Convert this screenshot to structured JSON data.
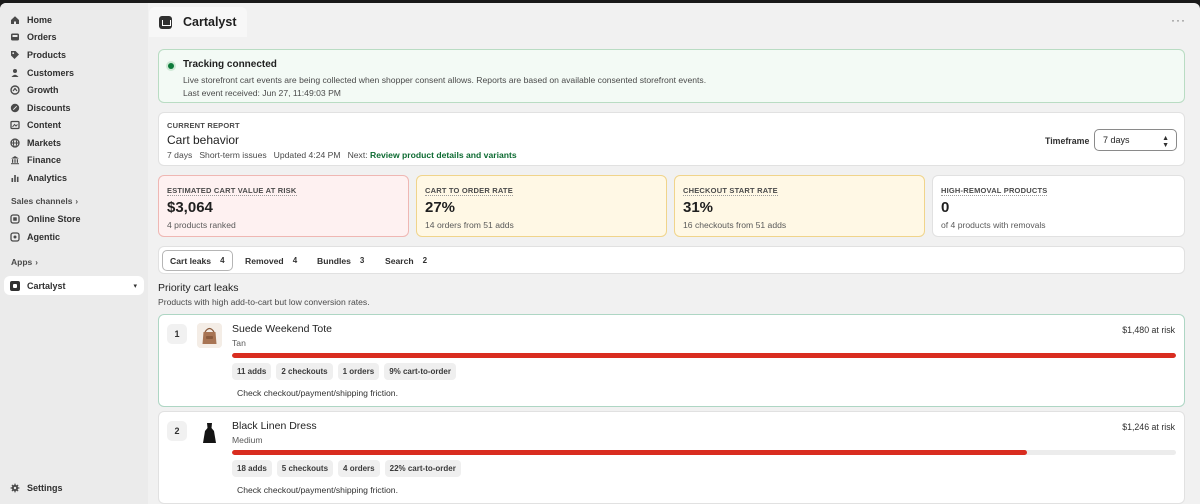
{
  "sidebar": {
    "items": [
      {
        "label": "Home",
        "icon": "home-icon"
      },
      {
        "label": "Orders",
        "icon": "orders-icon"
      },
      {
        "label": "Products",
        "icon": "tag-icon"
      },
      {
        "label": "Customers",
        "icon": "person-icon"
      },
      {
        "label": "Growth",
        "icon": "growth-icon"
      },
      {
        "label": "Discounts",
        "icon": "discount-icon"
      },
      {
        "label": "Content",
        "icon": "content-icon"
      },
      {
        "label": "Markets",
        "icon": "globe-icon"
      },
      {
        "label": "Finance",
        "icon": "bank-icon"
      },
      {
        "label": "Analytics",
        "icon": "chart-bar-icon"
      }
    ],
    "sales_channels_heading": "Sales channels",
    "sales_channels": [
      {
        "label": "Online Store",
        "icon": "store-icon"
      },
      {
        "label": "Agentic",
        "icon": "agentic-icon"
      }
    ],
    "apps_heading": "Apps",
    "active_app": "Cartalyst",
    "settings_label": "Settings"
  },
  "header": {
    "app_title": "Cartalyst",
    "more_label": "···"
  },
  "banner": {
    "title": "Tracking connected",
    "description": "Live storefront cart events are being collected when shopper consent allows. Reports are based on available consented storefront events.",
    "last_event": "Last event received: Jun 27, 11:49:03 PM"
  },
  "report": {
    "eyebrow": "CURRENT REPORT",
    "title": "Cart behavior",
    "period": "7 days",
    "scope": "Short-term issues",
    "updated": "Updated 4:24 PM",
    "next_prefix": "Next:",
    "next_action": "Review product details and variants",
    "timeframe_label": "Timeframe",
    "timeframe_value": "7 days"
  },
  "metrics": [
    {
      "label": "ESTIMATED CART VALUE AT RISK",
      "value": "$3,064",
      "sub": "4 products ranked"
    },
    {
      "label": "CART TO ORDER RATE",
      "value": "27%",
      "sub": "14 orders from 51 adds"
    },
    {
      "label": "CHECKOUT START RATE",
      "value": "31%",
      "sub": "16 checkouts from 51 adds"
    },
    {
      "label": "HIGH-REMOVAL PRODUCTS",
      "value": "0",
      "sub": "of 4 products with removals"
    }
  ],
  "tabs": [
    {
      "label": "Cart leaks",
      "count": "4"
    },
    {
      "label": "Removed",
      "count": "4"
    },
    {
      "label": "Bundles",
      "count": "3"
    },
    {
      "label": "Search",
      "count": "2"
    }
  ],
  "list": {
    "title": "Priority cart leaks",
    "subtitle": "Products with high add-to-cart but low conversion rates."
  },
  "leaks": [
    {
      "rank": "1",
      "name": "Suede Weekend Tote",
      "variant": "Tan",
      "risk": "$1,480 at risk",
      "risk_fraction": 1.0,
      "chips": [
        "11 adds",
        "2 checkouts",
        "1 orders",
        "9% cart-to-order"
      ],
      "advice": "Check checkout/payment/shipping friction."
    },
    {
      "rank": "2",
      "name": "Black Linen Dress",
      "variant": "Medium",
      "risk": "$1,246 at risk",
      "risk_fraction": 0.842,
      "chips": [
        "18 adds",
        "5 checkouts",
        "4 orders",
        "22% cart-to-order"
      ],
      "advice": "Check checkout/payment/shipping friction."
    }
  ],
  "colors": {
    "risk_bar": "#d92d20",
    "tracking_ok": "#0d7a3a",
    "next_link": "#0d6b32"
  }
}
